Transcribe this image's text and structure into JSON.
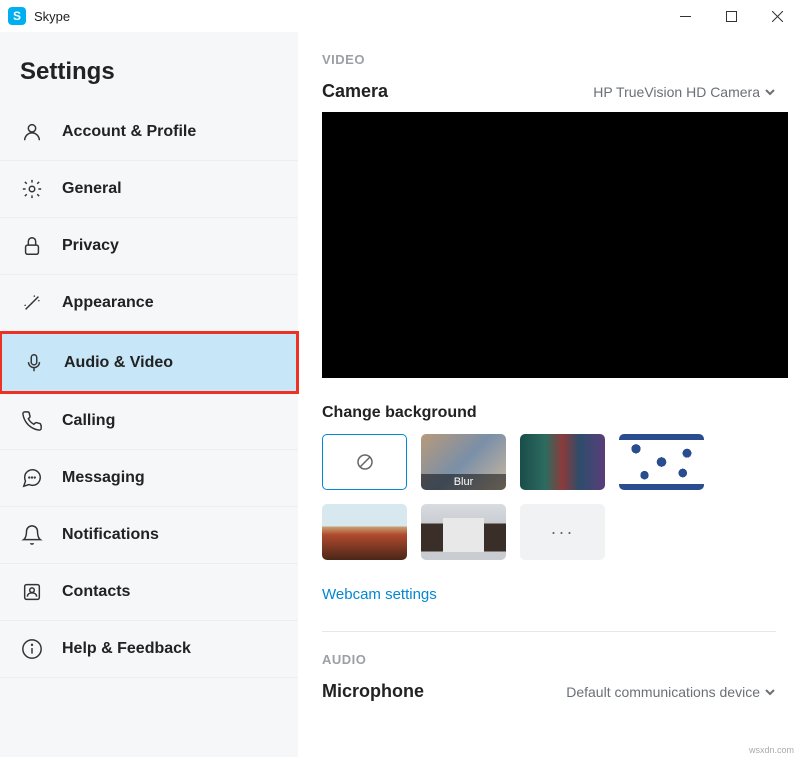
{
  "titlebar": {
    "app": "Skype"
  },
  "sidebar": {
    "title": "Settings",
    "items": [
      {
        "label": "Account & Profile"
      },
      {
        "label": "General"
      },
      {
        "label": "Privacy"
      },
      {
        "label": "Appearance"
      },
      {
        "label": "Audio & Video"
      },
      {
        "label": "Calling"
      },
      {
        "label": "Messaging"
      },
      {
        "label": "Notifications"
      },
      {
        "label": "Contacts"
      },
      {
        "label": "Help & Feedback"
      }
    ]
  },
  "main": {
    "video_section": "VIDEO",
    "camera_label": "Camera",
    "camera_value": "HP TrueVision HD Camera",
    "change_bg": "Change background",
    "blur_label": "Blur",
    "more_label": "···",
    "webcam_link": "Webcam settings",
    "audio_section": "AUDIO",
    "mic_label": "Microphone",
    "mic_value": "Default communications device"
  },
  "watermark": "wsxdn.com"
}
